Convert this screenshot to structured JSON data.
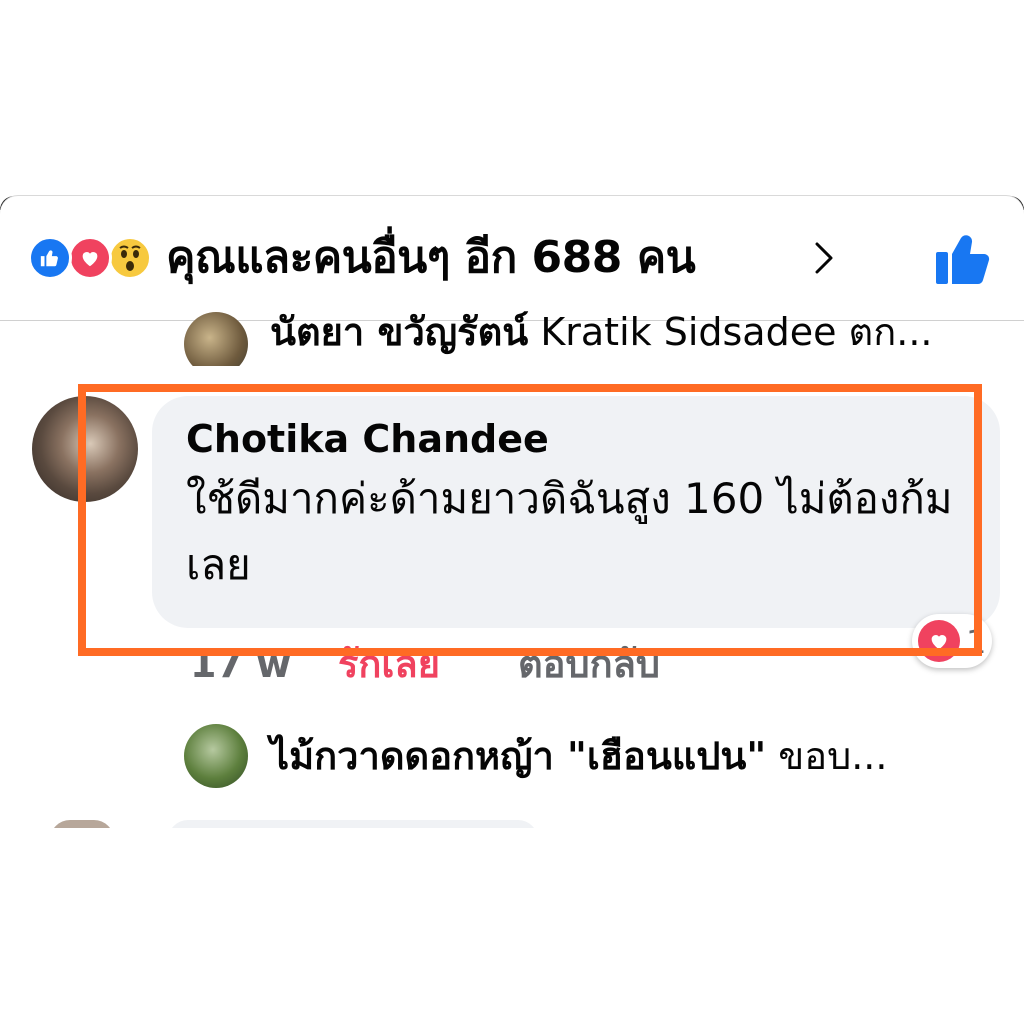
{
  "header": {
    "reactions": [
      "like-icon",
      "love-icon",
      "wow-icon"
    ],
    "summary": "คุณและคนอื่นๆ อีก 688 คน",
    "colors": {
      "like": "#1877f2",
      "love": "#f0425f",
      "wow": "#f7c93f"
    }
  },
  "comments": [
    {
      "author": "นัตยา ขวัญรัตน์",
      "text": "Kratik Sidsadee ตก..."
    },
    {
      "author": "Chotika Chandee",
      "text": "ใช้ดีมากค่ะด้ามยาวดิฉันสูง 160 ไม่ต้องก้มเลย",
      "time": "17 w",
      "love_label": "รักเลย",
      "reply_label": "ตอบกลับ",
      "reaction_count": "1"
    },
    {
      "author": "ไม้กวาดดอกหญ้า \"เฮือนแปน\"",
      "text": "ขอบ..."
    }
  ],
  "highlight": {
    "color": "#ff6b24"
  }
}
